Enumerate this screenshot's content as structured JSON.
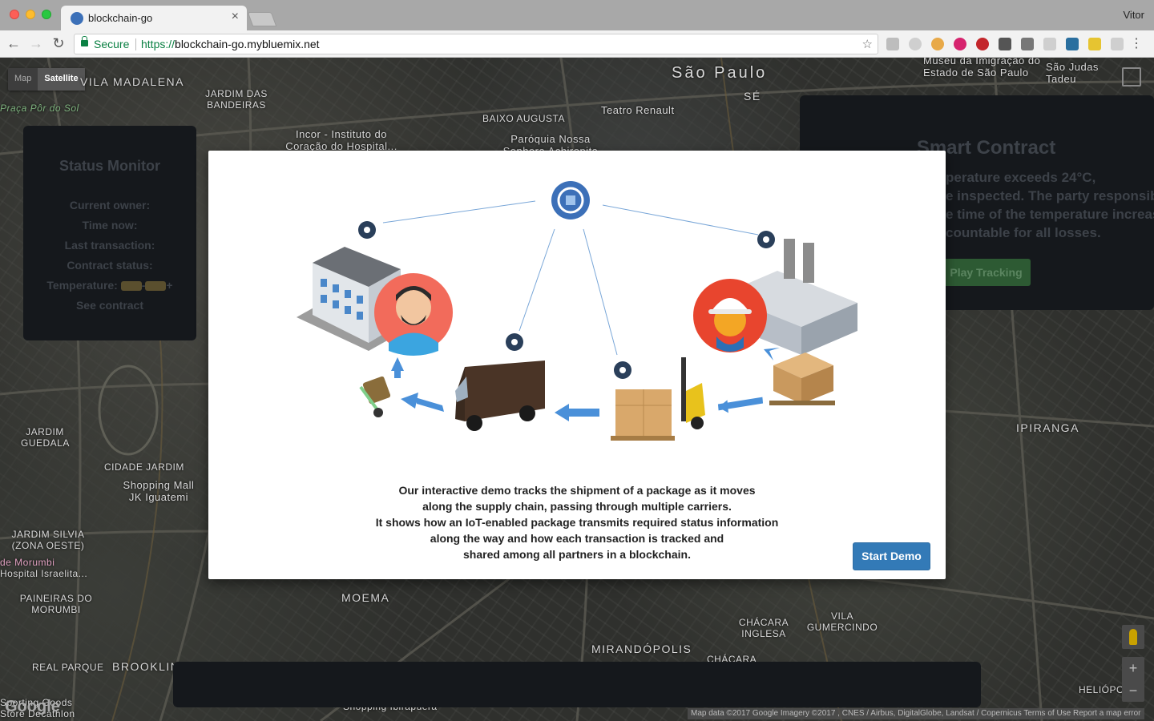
{
  "browser": {
    "tab_title": "blockchain-go",
    "tab_close": "×",
    "profile": "Vitor",
    "secure_label": "Secure",
    "url_scheme": "https://",
    "url_rest": "blockchain-go.mybluemix.net",
    "back": "←",
    "forward": "→",
    "reload": "↻",
    "star": "☆",
    "menu": "⋮"
  },
  "map": {
    "type_options": [
      "Map",
      "Satellite"
    ],
    "selected_type": "Satellite",
    "labels": [
      "VILA MADALENA",
      "JARDIM DAS BANDEIRAS",
      "São Paulo",
      "SÉ",
      "BAIXO AUGUSTA",
      "Teatro Renault",
      "Paróquia Nossa Senhora Achiropita",
      "Incor - Instituto do Coração do Hospital...",
      "Museu da Imigração do Estado de São Paulo",
      "São Judas Tadeu",
      "Praça Pôr do Sol",
      "JARDIM GUEDALA",
      "CIDADE JARDIM",
      "Shopping Mall JK Iguatemi",
      "JARDIM SILVIA (ZONA OESTE)",
      "PAINEIRAS DO MORUMBI",
      "REAL PARQUE",
      "BROOKLIN",
      "MOEMA",
      "MIRANDÓPOLIS",
      "CHÁCARA INGLESA",
      "VILA GUMERCINDO",
      "IPIRANGA",
      "Shopping Ibirapuera",
      "Hospital Israelita...",
      "de Morumbi",
      "Sporting Goods Store Decathlon",
      "HELIÓPOLIS",
      "CHÁCARA"
    ],
    "zoom_in": "+",
    "zoom_out": "−",
    "google": "Google",
    "attribution": "Map data ©2017 Google Imagery ©2017 , CNES / Airbus, DigitalGlobe, Landsat / Copernicus   Terms of Use   Report a map error"
  },
  "status_monitor": {
    "title": "Status Monitor",
    "current_owner": "Current owner:",
    "time_now": "Time now:",
    "last_transaction": "Last transaction:",
    "contract_status": "Contract status:",
    "temperature": "Temperature:",
    "temp_minus": "-",
    "temp_plus": "+",
    "see_contract": "See contract"
  },
  "smart_contract": {
    "title": "Smart Contract",
    "lines": [
      "perature exceeds 24°C,",
      "e inspected. The party responsible",
      "e time of the temperature increase",
      "countable for all losses."
    ],
    "play_button": "Play Tracking"
  },
  "modal": {
    "description": [
      "Our interactive demo tracks the shipment of a package as it moves",
      "along the supply chain, passing through multiple carriers.",
      "It shows how an IoT-enabled package transmits required status information",
      "along the way and how each transaction is tracked and",
      "shared among all partners in a blockchain."
    ],
    "start_button": "Start Demo"
  },
  "colors": {
    "modal_button": "#337ab7",
    "panel_bg": "#15181c",
    "play_button": "#2d5a33",
    "arrow": "#4a90d9",
    "blockchain_icon": "#3c70b8"
  }
}
